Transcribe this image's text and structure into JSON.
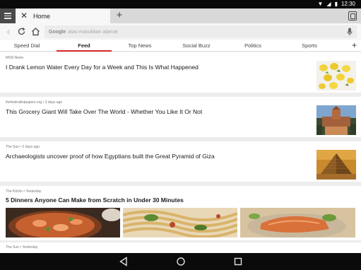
{
  "status_bar": {
    "time": "12:30"
  },
  "tab_strip": {
    "active_tab_title": "Home",
    "new_tab_label": "+"
  },
  "toolbar": {
    "search_engine": "Google",
    "placeholder": "atau masukkan alamat"
  },
  "nav_tabs": {
    "items": [
      {
        "label": "Speed Dial",
        "active": false
      },
      {
        "label": "Feed",
        "active": true
      },
      {
        "label": "Top News",
        "active": false
      },
      {
        "label": "Social Buzz",
        "active": false
      },
      {
        "label": "Politics",
        "active": false
      },
      {
        "label": "Sports",
        "active": false
      }
    ],
    "add_label": "+"
  },
  "feed": {
    "articles": [
      {
        "source": "MSN News",
        "headline": "I Drank Lemon Water Every Day for a Week and This Is What Happened",
        "thumbnail": "lemons-photo"
      },
      {
        "source": "thefederalistpapers.org • 3 days ago",
        "headline": "This Grocery Giant Will Take Over The World - Whether You Like It Or Not",
        "thumbnail": "monument-photo"
      },
      {
        "source": "The Sun • 2 days ago",
        "headline": "Archaeologists uncover proof of how Egyptians built the Great Pyramid of Giza",
        "thumbnail": "pyramid-photo"
      }
    ],
    "featured": {
      "source": "The Kitchn • Yesterday",
      "headline": "5 Dinners Anyone Can Make from Scratch in Under 30 Minutes",
      "images": [
        "shrimp-dish-photo",
        "pasta-photo",
        "salmon-photo"
      ]
    },
    "next_item_source": "The Sun • Yesterday"
  },
  "colors": {
    "accent": "#d92b2b",
    "status_bar": "#0a0a0a",
    "feed_background": "#ededed"
  }
}
